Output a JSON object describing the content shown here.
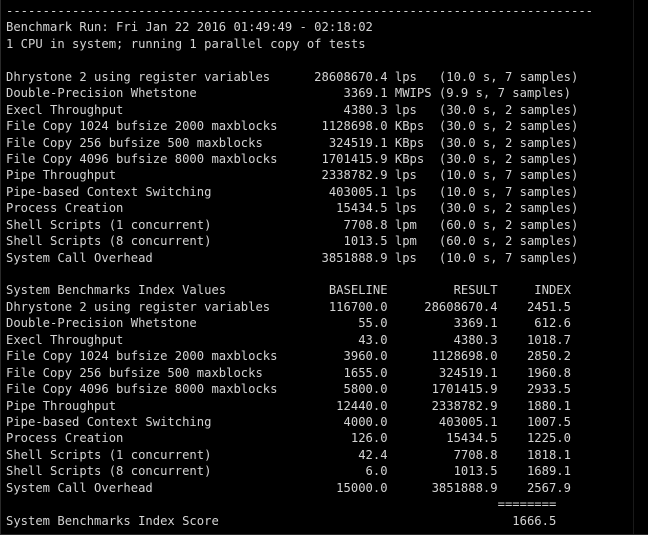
{
  "terminal": {
    "background_color": "#000000",
    "text_color": "#d4d4d4",
    "columns": 88,
    "rows": 32
  },
  "report": {
    "separator_top": "--------------------------------------------------------------------------------",
    "run_header_label": "Benchmark Run:",
    "run_header_value": "Fri Jan 22 2016 01:49:49 - 02:18:02",
    "cpu_line": "1 CPU in system; running 1 parallel copy of tests"
  },
  "raw_results": {
    "rows": [
      {
        "name": "Dhrystone 2 using register variables",
        "value": "28608670.4",
        "unit": "lps",
        "detail": "(10.0 s, 7 samples)"
      },
      {
        "name": "Double-Precision Whetstone",
        "value": "3369.1",
        "unit": "MWIPS",
        "detail": "(9.9 s, 7 samples)"
      },
      {
        "name": "Execl Throughput",
        "value": "4380.3",
        "unit": "lps",
        "detail": "(30.0 s, 2 samples)"
      },
      {
        "name": "File Copy 1024 bufsize 2000 maxblocks",
        "value": "1128698.0",
        "unit": "KBps",
        "detail": "(30.0 s, 2 samples)"
      },
      {
        "name": "File Copy 256 bufsize 500 maxblocks",
        "value": "324519.1",
        "unit": "KBps",
        "detail": "(30.0 s, 2 samples)"
      },
      {
        "name": "File Copy 4096 bufsize 8000 maxblocks",
        "value": "1701415.9",
        "unit": "KBps",
        "detail": "(30.0 s, 2 samples)"
      },
      {
        "name": "Pipe Throughput",
        "value": "2338782.9",
        "unit": "lps",
        "detail": "(10.0 s, 7 samples)"
      },
      {
        "name": "Pipe-based Context Switching",
        "value": "403005.1",
        "unit": "lps",
        "detail": "(10.0 s, 7 samples)"
      },
      {
        "name": "Process Creation",
        "value": "15434.5",
        "unit": "lps",
        "detail": "(30.0 s, 2 samples)"
      },
      {
        "name": "Shell Scripts (1 concurrent)",
        "value": "7708.8",
        "unit": "lpm",
        "detail": "(60.0 s, 2 samples)"
      },
      {
        "name": "Shell Scripts (8 concurrent)",
        "value": "1013.5",
        "unit": "lpm",
        "detail": "(60.0 s, 2 samples)"
      },
      {
        "name": "System Call Overhead",
        "value": "3851888.9",
        "unit": "lps",
        "detail": "(10.0 s, 7 samples)"
      }
    ]
  },
  "index_values": {
    "title": "System Benchmarks Index Values",
    "columns": [
      "BASELINE",
      "RESULT",
      "INDEX"
    ],
    "rows": [
      {
        "name": "Dhrystone 2 using register variables",
        "baseline": "116700.0",
        "result": "28608670.4",
        "index": "2451.5"
      },
      {
        "name": "Double-Precision Whetstone",
        "baseline": "55.0",
        "result": "3369.1",
        "index": "612.6"
      },
      {
        "name": "Execl Throughput",
        "baseline": "43.0",
        "result": "4380.3",
        "index": "1018.7"
      },
      {
        "name": "File Copy 1024 bufsize 2000 maxblocks",
        "baseline": "3960.0",
        "result": "1128698.0",
        "index": "2850.2"
      },
      {
        "name": "File Copy 256 bufsize 500 maxblocks",
        "baseline": "1655.0",
        "result": "324519.1",
        "index": "1960.8"
      },
      {
        "name": "File Copy 4096 bufsize 8000 maxblocks",
        "baseline": "5800.0",
        "result": "1701415.9",
        "index": "2933.5"
      },
      {
        "name": "Pipe Throughput",
        "baseline": "12440.0",
        "result": "2338782.9",
        "index": "1880.1"
      },
      {
        "name": "Pipe-based Context Switching",
        "baseline": "4000.0",
        "result": "403005.1",
        "index": "1007.5"
      },
      {
        "name": "Process Creation",
        "baseline": "126.0",
        "result": "15434.5",
        "index": "1225.0"
      },
      {
        "name": "Shell Scripts (1 concurrent)",
        "baseline": "42.4",
        "result": "7708.8",
        "index": "1818.1"
      },
      {
        "name": "Shell Scripts (8 concurrent)",
        "baseline": "6.0",
        "result": "1013.5",
        "index": "1689.1"
      },
      {
        "name": "System Call Overhead",
        "baseline": "15000.0",
        "result": "3851888.9",
        "index": "2567.9"
      }
    ],
    "rule": "========",
    "score_label": "System Benchmarks Index Score",
    "score_value": "1666.5"
  }
}
